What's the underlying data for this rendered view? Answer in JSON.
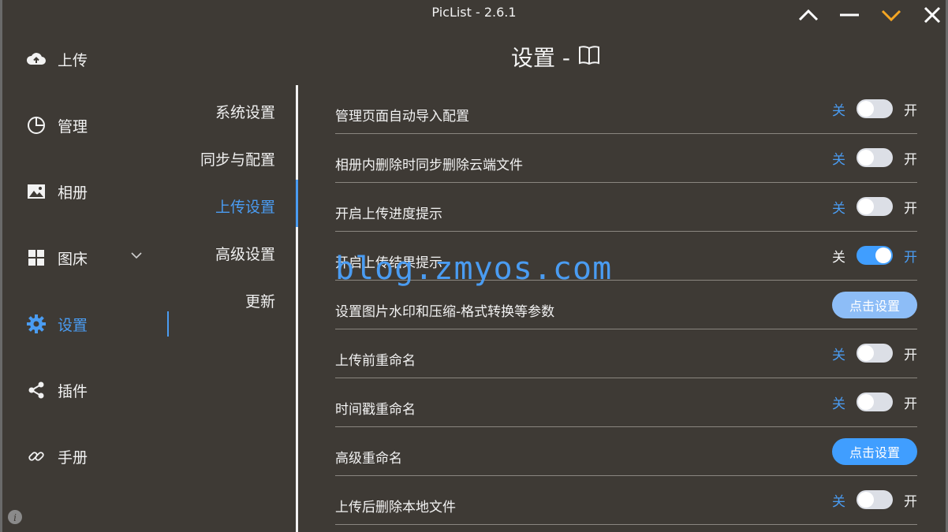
{
  "window": {
    "title": "PicList - 2.6.1"
  },
  "title_controls": [
    {
      "name": "collapse-up-icon",
      "color": "#ffffff"
    },
    {
      "name": "minimize-icon",
      "color": "#ffffff"
    },
    {
      "name": "miniwindow-down-icon",
      "color": "#f5a623"
    },
    {
      "name": "close-icon",
      "color": "#ffffff"
    }
  ],
  "sidebar": {
    "items": [
      {
        "label": "上传",
        "icon": "cloud-upload-icon"
      },
      {
        "label": "管理",
        "icon": "pie-chart-icon"
      },
      {
        "label": "相册",
        "icon": "picture-icon"
      },
      {
        "label": "图床",
        "icon": "grid-icon",
        "has_chevron": true
      },
      {
        "label": "设置",
        "icon": "gear-icon",
        "active": true
      },
      {
        "label": "插件",
        "icon": "share-icon"
      },
      {
        "label": "手册",
        "icon": "link-icon"
      }
    ]
  },
  "page": {
    "title": "设置 -",
    "icon": "book-icon"
  },
  "subnav": {
    "items": [
      {
        "label": "系统设置"
      },
      {
        "label": "同步与配置"
      },
      {
        "label": "上传设置",
        "active": true
      },
      {
        "label": "高级设置"
      },
      {
        "label": "更新"
      }
    ]
  },
  "switch_labels": {
    "off": "关",
    "on": "开"
  },
  "settings": [
    {
      "label": "管理页面自动导入配置",
      "type": "switch",
      "on": false
    },
    {
      "label": "相册内删除时同步删除云端文件",
      "type": "switch",
      "on": false
    },
    {
      "label": "开启上传进度提示",
      "type": "switch",
      "on": false
    },
    {
      "label": "开启上传结果提示",
      "type": "switch",
      "on": true
    },
    {
      "label": "设置图片水印和压缩-格式转换等参数",
      "type": "button",
      "button_label": "点击设置",
      "button_style": "light"
    },
    {
      "label": "上传前重命名",
      "type": "switch",
      "on": false
    },
    {
      "label": "时间戳重命名",
      "type": "switch",
      "on": false
    },
    {
      "label": "高级重命名",
      "type": "button",
      "button_label": "点击设置",
      "button_style": "primary"
    },
    {
      "label": "上传后删除本地文件",
      "type": "switch",
      "on": false
    }
  ],
  "watermark": {
    "text": "blog.zmyos.com"
  },
  "colors": {
    "background": "#3e3a35",
    "accent": "#409eff",
    "active_text": "#4a9cf2",
    "toggle_off": "#dcdfe6"
  }
}
